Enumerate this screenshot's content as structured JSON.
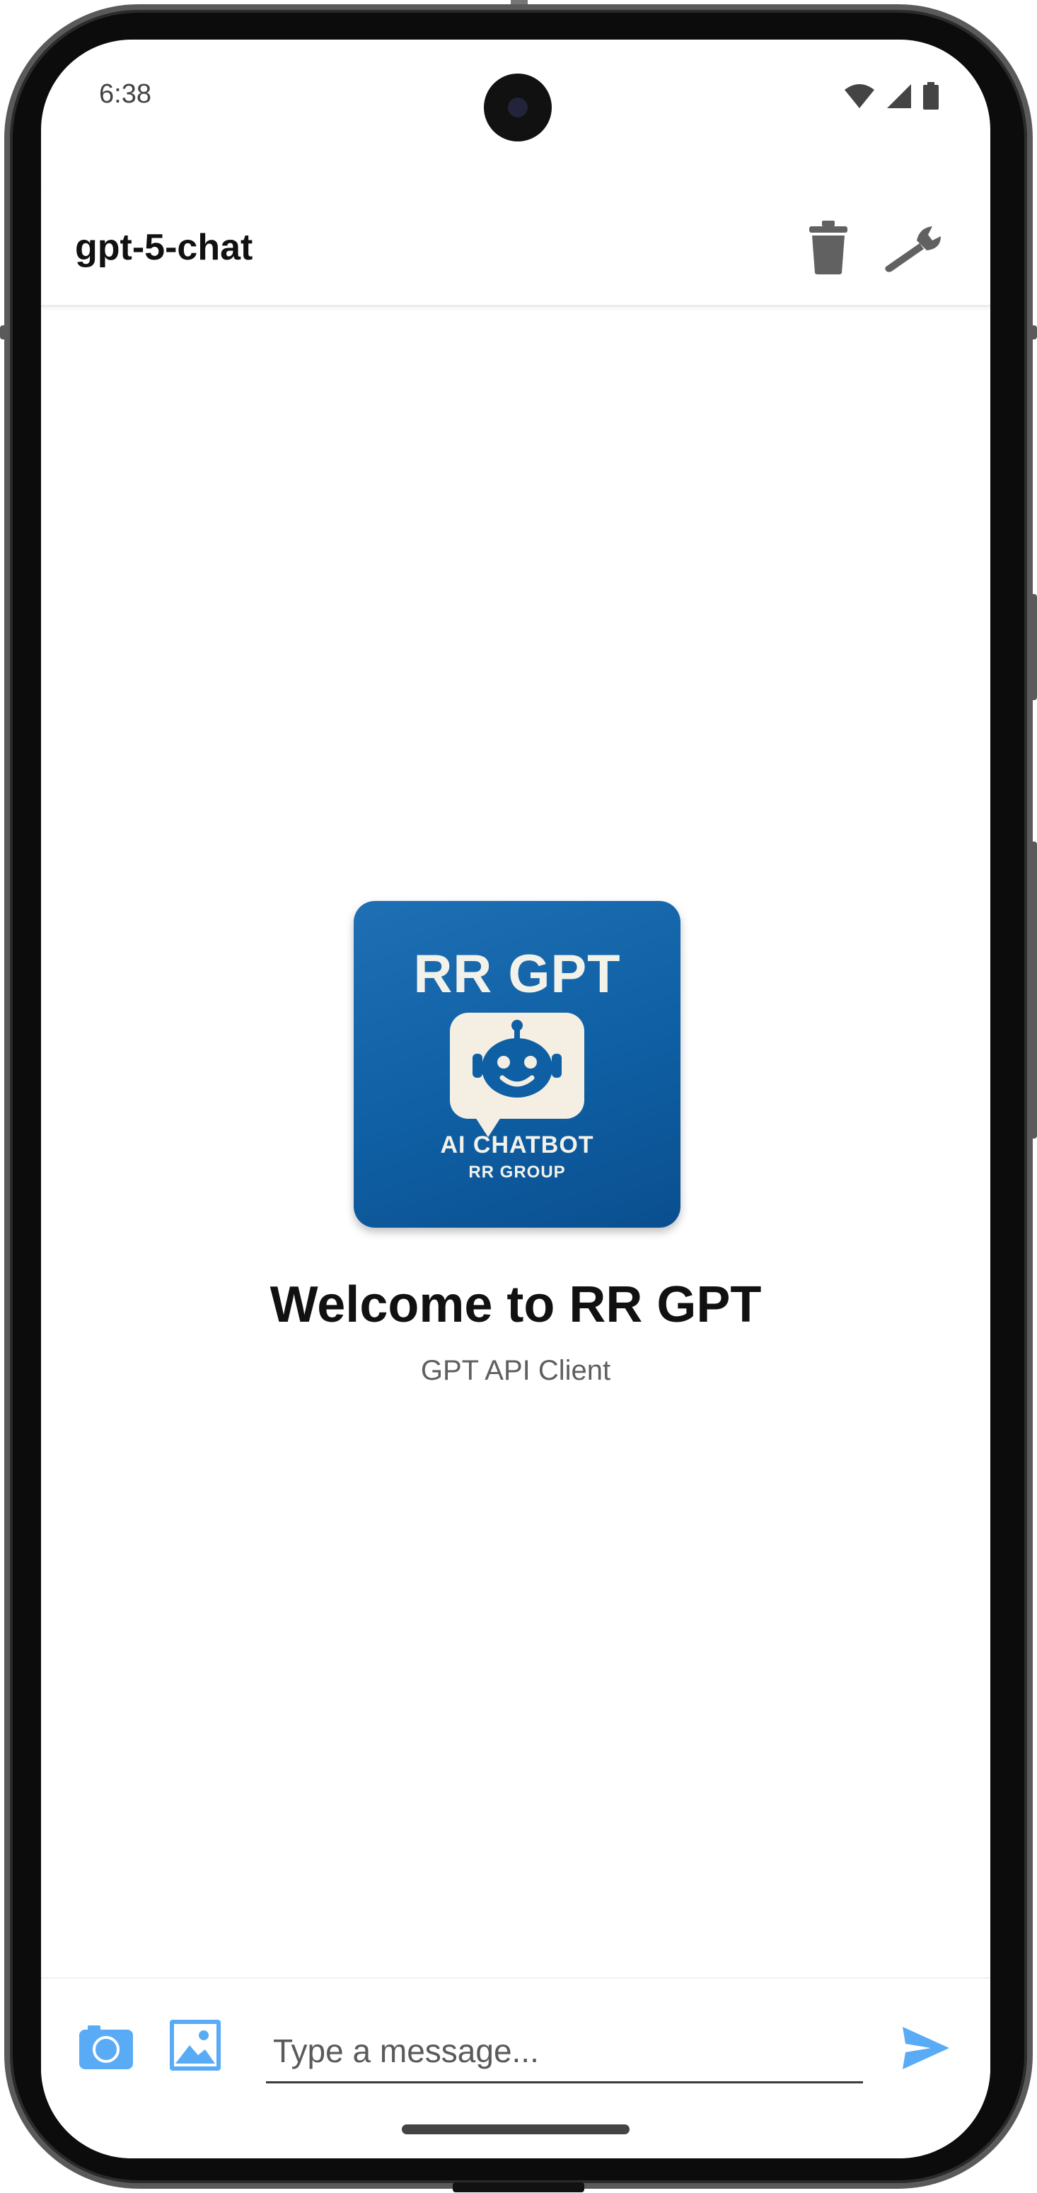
{
  "status_bar": {
    "time": "6:38",
    "icons": [
      "wifi-icon",
      "signal-icon",
      "battery-icon"
    ]
  },
  "header": {
    "title": "gpt-5-chat",
    "actions": [
      {
        "name": "delete-chat-button",
        "icon": "trash-icon"
      },
      {
        "name": "settings-button",
        "icon": "wrench-icon"
      }
    ]
  },
  "logo": {
    "title": "RR GPT",
    "line1": "AI CHATBOT",
    "line2": "RR GROUP",
    "icon": "robot-icon"
  },
  "welcome": {
    "title": "Welcome to RR GPT",
    "subtitle": "GPT API Client"
  },
  "composer": {
    "placeholder": "Type a message...",
    "value": "",
    "actions": [
      {
        "name": "camera-button",
        "icon": "camera-icon"
      },
      {
        "name": "gallery-button",
        "icon": "image-icon"
      },
      {
        "name": "send-button",
        "icon": "send-icon"
      }
    ]
  },
  "colors": {
    "accent": "#5aabf5",
    "logo_blue": "#0f5fa4",
    "header_icon": "#616161",
    "text_primary": "#111111",
    "text_secondary": "#5f5f5f"
  }
}
